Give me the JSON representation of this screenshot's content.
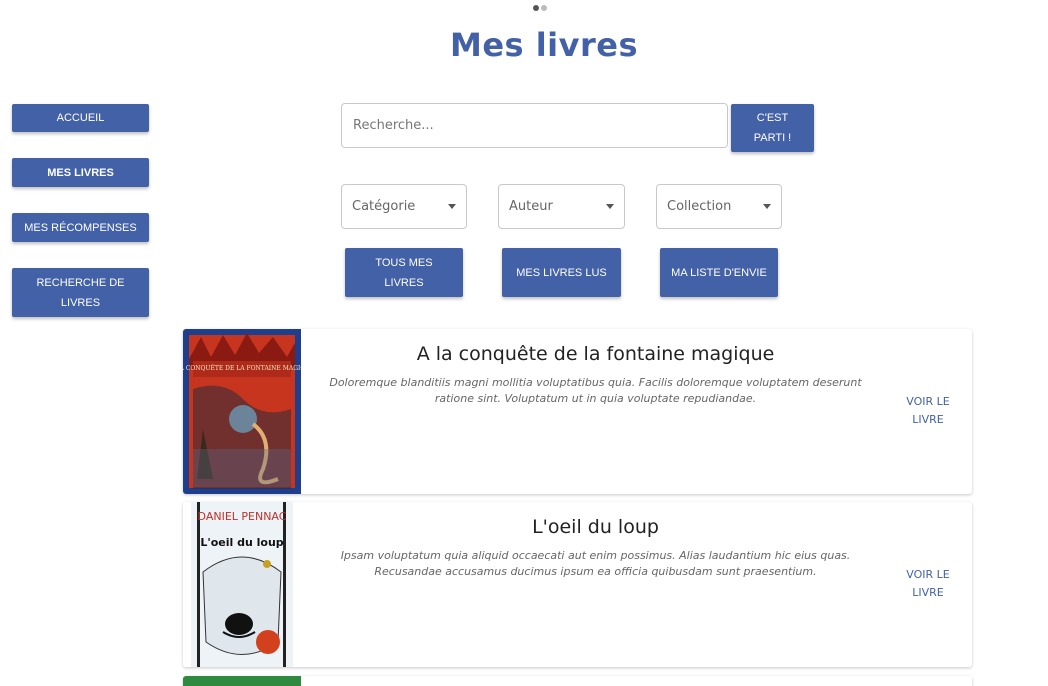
{
  "title": "Mes livres",
  "sidebar": {
    "items": [
      {
        "label": "ACCUEIL"
      },
      {
        "label": "MES LIVRES"
      },
      {
        "label": "MES RÉCOMPENSES"
      },
      {
        "label": "RECHERCHE DE LIVRES"
      }
    ]
  },
  "search": {
    "placeholder": "Recherche...",
    "button_label": "C'EST PARTI !"
  },
  "filters": {
    "category": "Catégorie",
    "author": "Auteur",
    "collection": "Collection"
  },
  "tabs": {
    "all": "TOUS MES LIVRES",
    "read": "MES LIVRES LUS",
    "wishlist": "MA LISTE D'ENVIE"
  },
  "books": [
    {
      "title": "A la conquête de la fontaine magique",
      "description": "Doloremque blanditiis magni mollitia voluptatibus quia. Facilis doloremque voluptatem deserunt ratione sint. Voluptatum ut in quia voluptate repudiandae.",
      "link": "VOIR LE LIVRE",
      "cover_text": "A LA CONQUÊTE DE LA FONTAINE MAGIQUE"
    },
    {
      "title": "L'oeil du loup",
      "description": "Ipsam voluptatum quia aliquid occaecati aut enim possimus. Alias laudantium hic eius quas. Recusandae accusamus ducimus ipsum ea officia quibusdam sunt praesentium.",
      "link": "VOIR LE LIVRE",
      "cover_author": "DANIEL PENNAC",
      "cover_title": "L'oeil du loup"
    }
  ],
  "colors": {
    "primary": "#4361a6"
  }
}
